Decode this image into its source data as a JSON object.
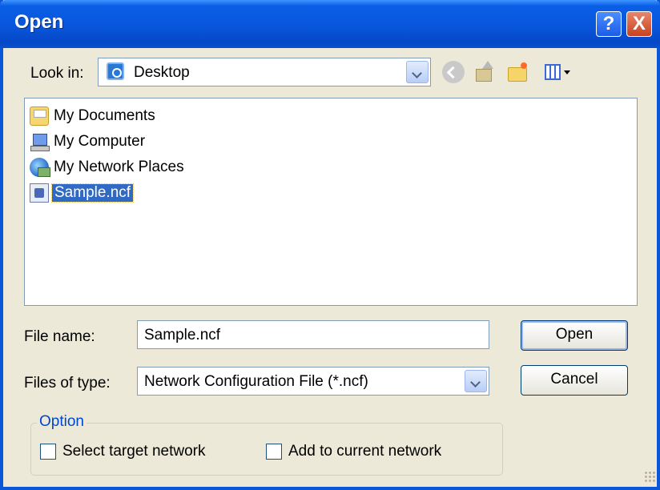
{
  "window": {
    "title": "Open",
    "help_button": "?",
    "close_button": "X"
  },
  "lookin": {
    "label": "Look in:",
    "value": "Desktop"
  },
  "toolbar": {
    "icons": [
      "back-icon",
      "up-one-level-icon",
      "new-folder-icon",
      "views-menu-icon"
    ]
  },
  "files": [
    {
      "name": "My Documents",
      "icon": "my-documents-icon"
    },
    {
      "name": "My Computer",
      "icon": "my-computer-icon"
    },
    {
      "name": "My Network Places",
      "icon": "network-places-icon"
    },
    {
      "name": "Sample.ncf",
      "icon": "ncf-file-icon",
      "selected": true
    }
  ],
  "filename": {
    "label": "File name:",
    "value": "Sample.ncf"
  },
  "filetype": {
    "label": "Files of type:",
    "value": "Network Configuration File (*.ncf)"
  },
  "buttons": {
    "open": "Open",
    "cancel": "Cancel"
  },
  "option": {
    "legend": "Option",
    "select_target": "Select target network",
    "add_current": "Add to current network",
    "select_target_checked": false,
    "add_current_checked": false
  },
  "colors": {
    "title_bar": "#0856dc",
    "dialog_bg": "#ece9d8",
    "selection": "#316ac5",
    "option_legend": "#0046d5"
  }
}
